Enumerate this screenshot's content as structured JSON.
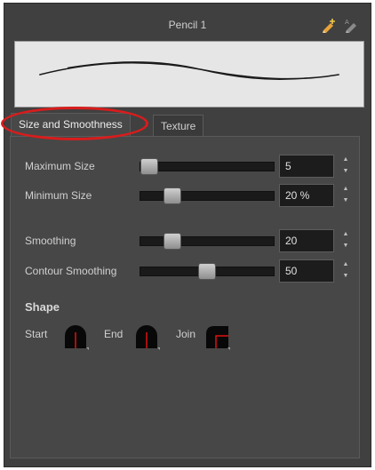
{
  "panel": {
    "title": "Pencil 1",
    "icons": [
      "new-preset-icon",
      "rename-preset-icon"
    ]
  },
  "tabs": [
    {
      "label": "Size and Smoothness",
      "active": true
    },
    {
      "label": "Texture",
      "active": false
    }
  ],
  "sliders": {
    "maximum_size": {
      "label": "Maximum Size",
      "value": "5",
      "fraction": 0.0
    },
    "minimum_size": {
      "label": "Minimum Size",
      "value": "20 %",
      "fraction": 0.2
    },
    "smoothing": {
      "label": "Smoothing",
      "value": "20",
      "fraction": 0.2
    },
    "contour_smoothing": {
      "label": "Contour Smoothing",
      "value": "50",
      "fraction": 0.5
    }
  },
  "shape": {
    "title": "Shape",
    "start_label": "Start",
    "end_label": "End",
    "join_label": "Join",
    "start_icon": "round-cap-icon",
    "end_icon": "round-cap-icon",
    "join_icon": "round-join-icon"
  },
  "colors": {
    "panel_bg": "#404040",
    "highlight": "#d91c1c",
    "shape_marker": "#e01010"
  }
}
